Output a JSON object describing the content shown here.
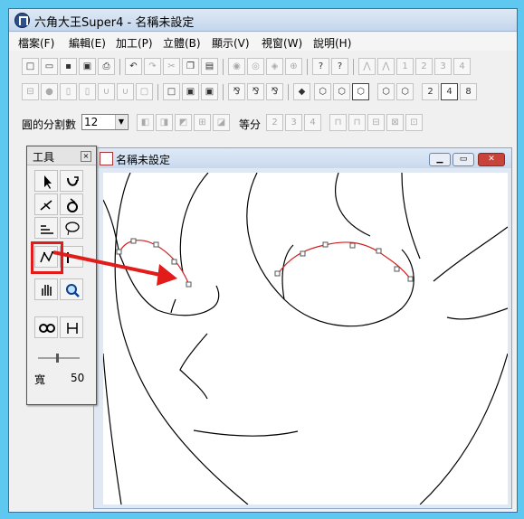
{
  "window": {
    "title": "六角大王Super4 - 名稱未設定"
  },
  "menu": {
    "items": [
      "檔案(F)",
      "編輯(E)",
      "加工(P)",
      "立體(B)",
      "顯示(V)",
      "視窗(W)",
      "說明(H)"
    ]
  },
  "toolbar1": {
    "numbers": [
      "1",
      "2",
      "3",
      "4"
    ]
  },
  "toolbar2": {
    "numbers": [
      "2",
      "4",
      "8"
    ]
  },
  "toolbar3": {
    "segments_label": "圓的分割數",
    "segments_value": "12",
    "equal_label": "等分",
    "equal_numbers": [
      "2",
      "3",
      "4"
    ]
  },
  "tools_panel": {
    "title": "工具",
    "width_label": "寬",
    "width_value": "50"
  },
  "document": {
    "title": "名稱未設定"
  },
  "colors": {
    "highlight": "#e21b1b",
    "desktop": "#5ec8f0"
  },
  "icons": [
    "app-logo-icon",
    "new-file-icon",
    "open-folder-icon",
    "save-icon",
    "print-icon",
    "undo-icon",
    "redo-icon",
    "cut-icon",
    "copy-icon",
    "paste-icon",
    "help-icon",
    "pointer-icon",
    "rotate-icon",
    "curve-pen-icon",
    "hand-icon",
    "zoom-icon"
  ]
}
